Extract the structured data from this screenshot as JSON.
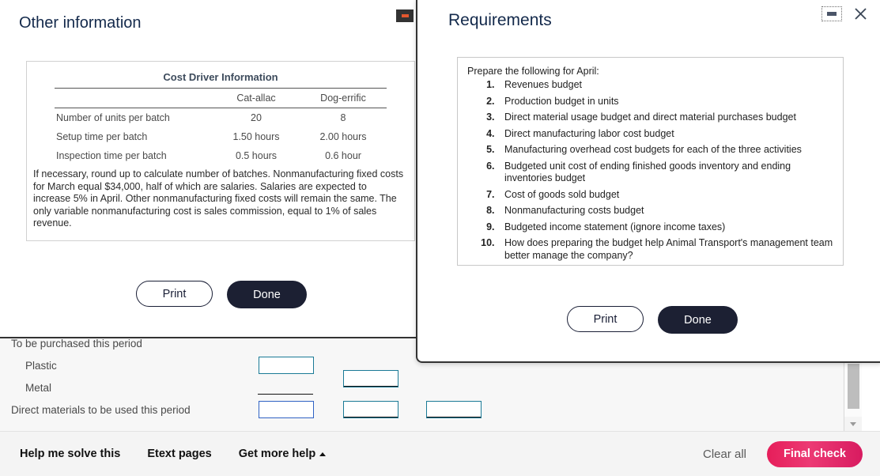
{
  "worksheet": {
    "rows": [
      {
        "label": "To be purchased this period",
        "indent": "flush"
      },
      {
        "label": "Plastic",
        "indent": "indent"
      },
      {
        "label": "Metal",
        "indent": "indent"
      },
      {
        "label": "Direct materials to be used this period",
        "indent": "flush"
      }
    ]
  },
  "dialog_other": {
    "title": "Other information",
    "minimize_icon": "minimize-icon",
    "exhibit": {
      "title": "Cost Driver Information",
      "columns": [
        "",
        "Cat-allac",
        "Dog-errific"
      ],
      "rows": [
        {
          "label": "Number of units per batch",
          "cat_allac": "20",
          "dog_errific": "8"
        },
        {
          "label": "Setup time per batch",
          "cat_allac": "1.50 hours",
          "dog_errific": "2.00 hours"
        },
        {
          "label": "Inspection time per batch",
          "cat_allac": "0.5 hours",
          "dog_errific": "0.6 hour"
        }
      ],
      "note": "If necessary, round up to calculate number of batches. Nonmanufacturing fixed costs for March equal $34,000, half of which are salaries. Salaries are expected to increase 5% in April. Other nonmanufacturing fixed costs will remain the same. The only variable nonmanufacturing cost is sales commission, equal to 1% of sales revenue."
    },
    "buttons": {
      "print": "Print",
      "done": "Done"
    }
  },
  "dialog_requirements": {
    "title": "Requirements",
    "minimize_icon": "minimize-icon",
    "close_icon": "close-icon",
    "intro": "Prepare the following for April:",
    "items": [
      "Revenues budget",
      "Production budget in units",
      "Direct material usage budget and direct material purchases budget",
      "Direct manufacturing labor cost budget",
      "Manufacturing overhead cost budgets for each of the three activities",
      "Budgeted unit cost of ending finished goods inventory and ending inventories budget",
      "Cost of goods sold budget",
      "Nonmanufacturing costs budget",
      "Budgeted income statement (ignore income taxes)",
      "How does preparing the budget help Animal Transport's management team better manage the company?"
    ],
    "buttons": {
      "print": "Print",
      "done": "Done"
    }
  },
  "footer": {
    "help_me_solve_this": "Help me solve this",
    "etext_pages": "Etext pages",
    "get_more_help": "Get more help",
    "get_more_help_icon": "caret-up-icon",
    "clear_all": "Clear all",
    "final_check": "Final check"
  },
  "colors": {
    "accent_final_check": "#e61e5a",
    "dialog_border": "#333333",
    "title_text": "#13294b",
    "input_border_teal": "#1a7a96",
    "input_border_blue": "#2f62c4",
    "done_button": "#1c2033"
  },
  "scrollbar": {
    "down_arrow_icon": "chevron-down-icon"
  }
}
